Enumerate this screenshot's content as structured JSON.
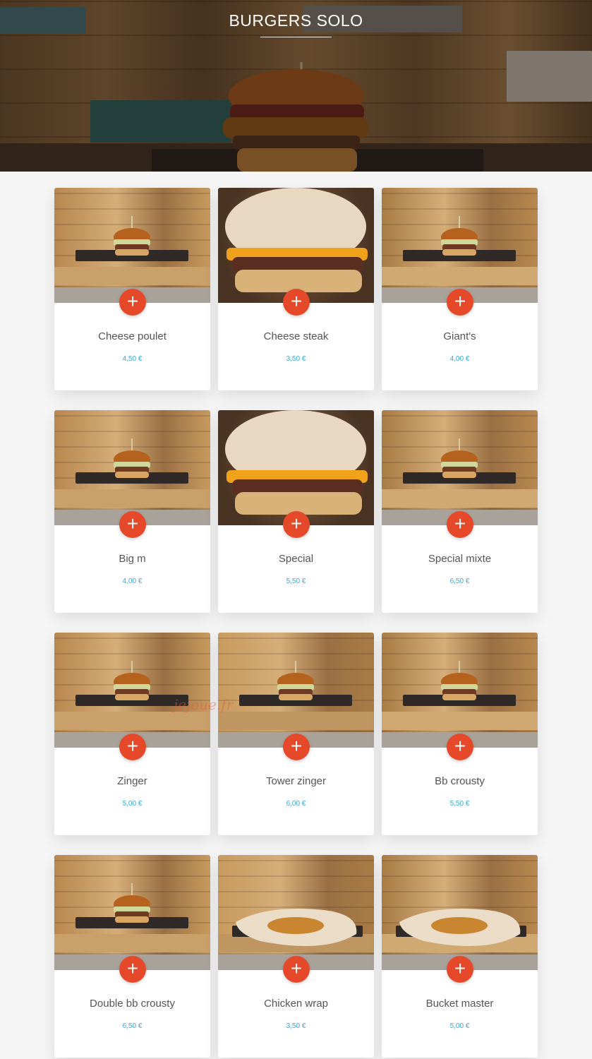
{
  "header": {
    "title": "BURGERS SOLO"
  },
  "colors": {
    "accent": "#e6482a",
    "price": "#3aa7d6",
    "name": "#555555",
    "background": "#f5f5f5"
  },
  "add_icon": "plus-icon",
  "watermark": "jejoue.fr",
  "products": [
    {
      "name": "Cheese poulet",
      "price": "4,50 €",
      "image": "burger-photo"
    },
    {
      "name": "Cheese steak",
      "price": "3,50 €",
      "image": "burger-closeup-photo"
    },
    {
      "name": "Giant's",
      "price": "4,00 €",
      "image": "burger-photo"
    },
    {
      "name": "Big m",
      "price": "4,00 €",
      "image": "burger-photo"
    },
    {
      "name": "Special",
      "price": "5,50 €",
      "image": "burger-closeup-photo"
    },
    {
      "name": "Special mixte",
      "price": "6,50 €",
      "image": "burger-photo"
    },
    {
      "name": "Zinger",
      "price": "5,00 €",
      "image": "burger-photo"
    },
    {
      "name": "Tower zinger",
      "price": "6,00 €",
      "image": "burger-photo"
    },
    {
      "name": "Bb crousty",
      "price": "5,50 €",
      "image": "burger-photo"
    },
    {
      "name": "Double bb crousty",
      "price": "6,50 €",
      "image": "burger-photo"
    },
    {
      "name": "Chicken wrap",
      "price": "3,50 €",
      "image": "wrap-photo"
    },
    {
      "name": "Bucket master",
      "price": "5,00 €",
      "image": "wrap-photo"
    }
  ]
}
